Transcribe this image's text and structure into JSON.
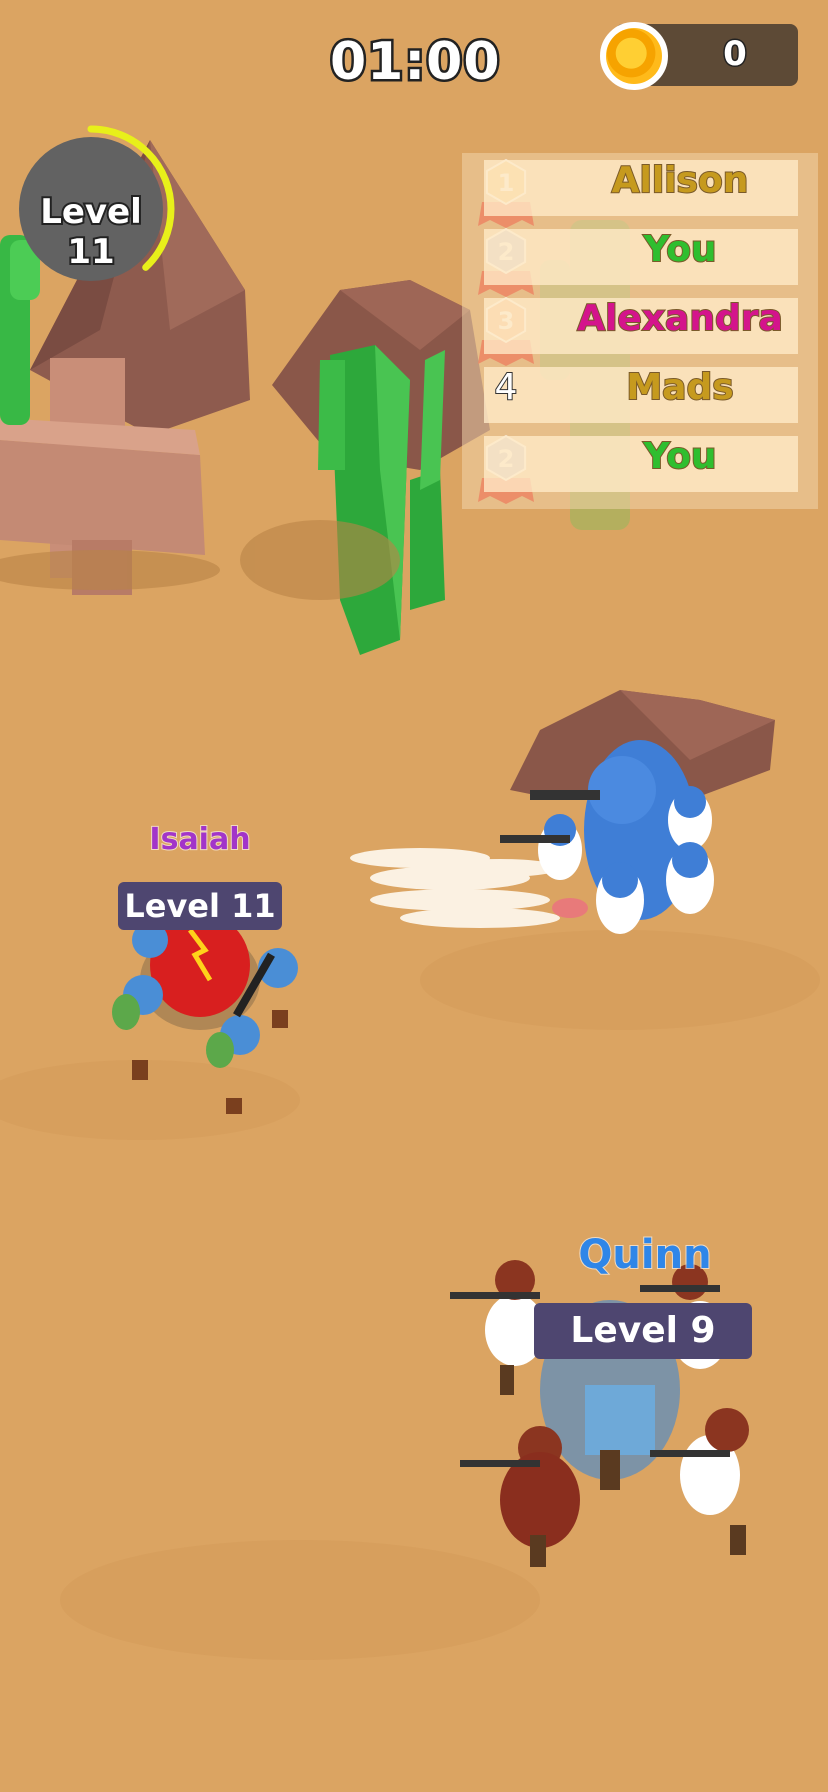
{
  "hud": {
    "timer": "01:00",
    "coins": "0",
    "level": "Level 11",
    "level_progress": 0.38
  },
  "leaderboard": [
    {
      "rank": "1",
      "name": "Allison",
      "name_color": "#c69a1e",
      "medal_color": "#f2a81d"
    },
    {
      "rank": "2",
      "name": "You",
      "name_color": "#2fbe2f",
      "medal_color": "#9aa0c8"
    },
    {
      "rank": "3",
      "name": "Alexandra",
      "name_color": "#d4148c",
      "medal_color": "#f07a2a"
    },
    {
      "rank": "4",
      "name": "Mads",
      "name_color": "#c69a1e",
      "medal_color": ""
    },
    {
      "rank": "2",
      "name": "You",
      "name_color": "#2fbe2f",
      "medal_color": "#9aa0c8"
    }
  ],
  "players": {
    "isaiah": {
      "name": "Isaiah",
      "level": "Level 11",
      "color": "#a235c9"
    },
    "quinn": {
      "name": "Quinn",
      "level": "Level 9",
      "color": "#2f86e8"
    }
  }
}
